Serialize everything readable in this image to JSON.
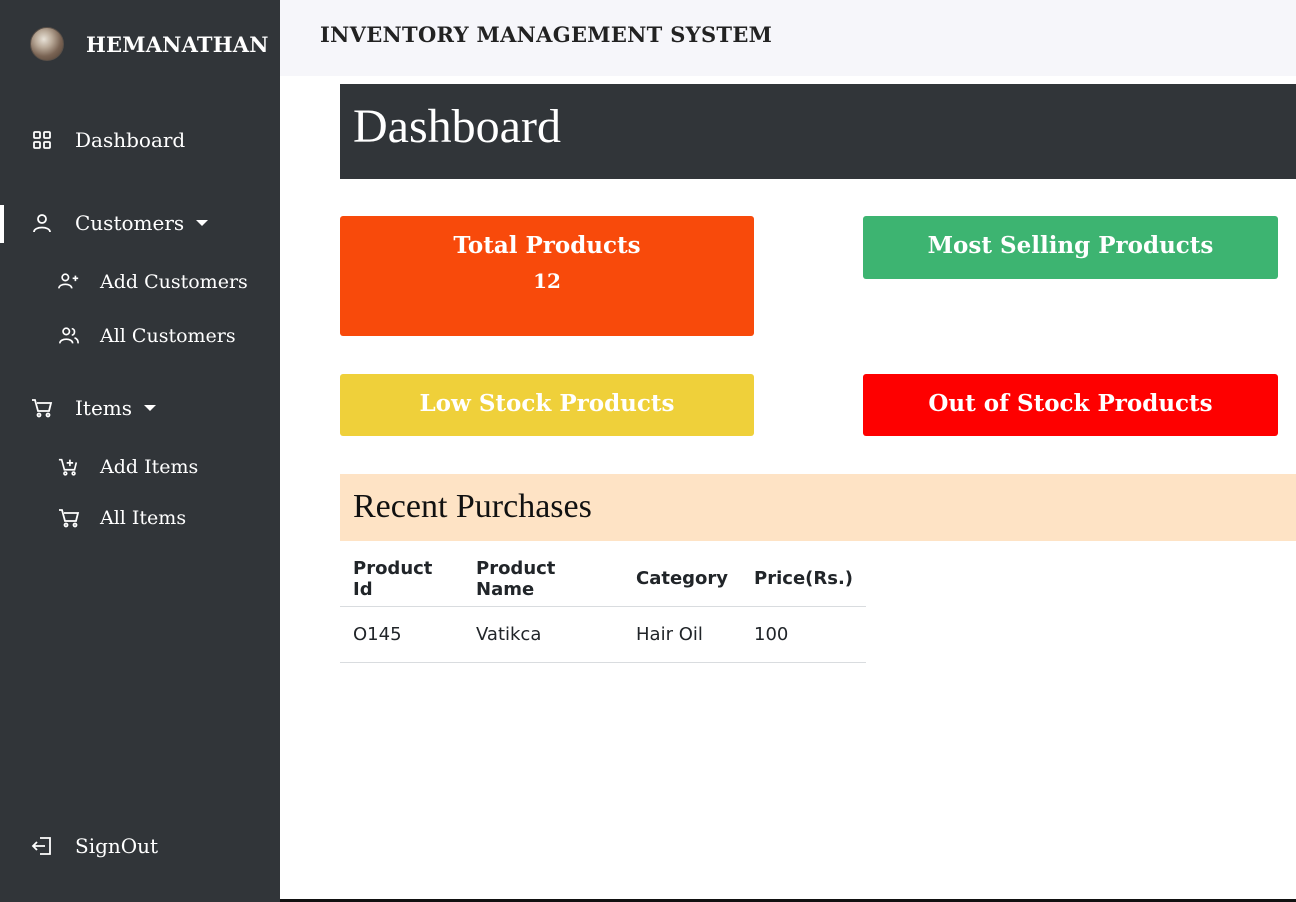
{
  "sidebar": {
    "brand_name": "HEMANATHAN",
    "items": [
      {
        "label": "Dashboard",
        "icon": "grid-icon"
      },
      {
        "label": "Customers",
        "icon": "user-icon"
      },
      {
        "label": "Add Customers",
        "icon": "user-plus-icon"
      },
      {
        "label": "All Customers",
        "icon": "users-icon"
      },
      {
        "label": "Items",
        "icon": "cart-icon"
      },
      {
        "label": "Add Items",
        "icon": "cart-plus-icon"
      },
      {
        "label": "All Items",
        "icon": "cart-icon"
      },
      {
        "label": "SignOut",
        "icon": "sign-out-icon"
      }
    ]
  },
  "header": {
    "title": "INVENTORY MANAGEMENT SYSTEM"
  },
  "main": {
    "page_title": "Dashboard",
    "cards": {
      "total_products": {
        "title": "Total Products",
        "value": "12",
        "color": "#f84a0b"
      },
      "most_selling": {
        "title": "Most Selling Products",
        "color": "#3db471"
      },
      "low_stock": {
        "title": "Low Stock Products",
        "color": "#efd03a"
      },
      "out_of_stock": {
        "title": "Out of Stock Products",
        "color": "#fe0000"
      }
    },
    "recent_purchases": {
      "title": "Recent Purchases",
      "columns": [
        "Product Id",
        "Product Name",
        "Category",
        "Price(Rs.)"
      ],
      "rows": [
        [
          "O145",
          "Vatikca",
          "Hair Oil",
          "100"
        ]
      ]
    }
  }
}
